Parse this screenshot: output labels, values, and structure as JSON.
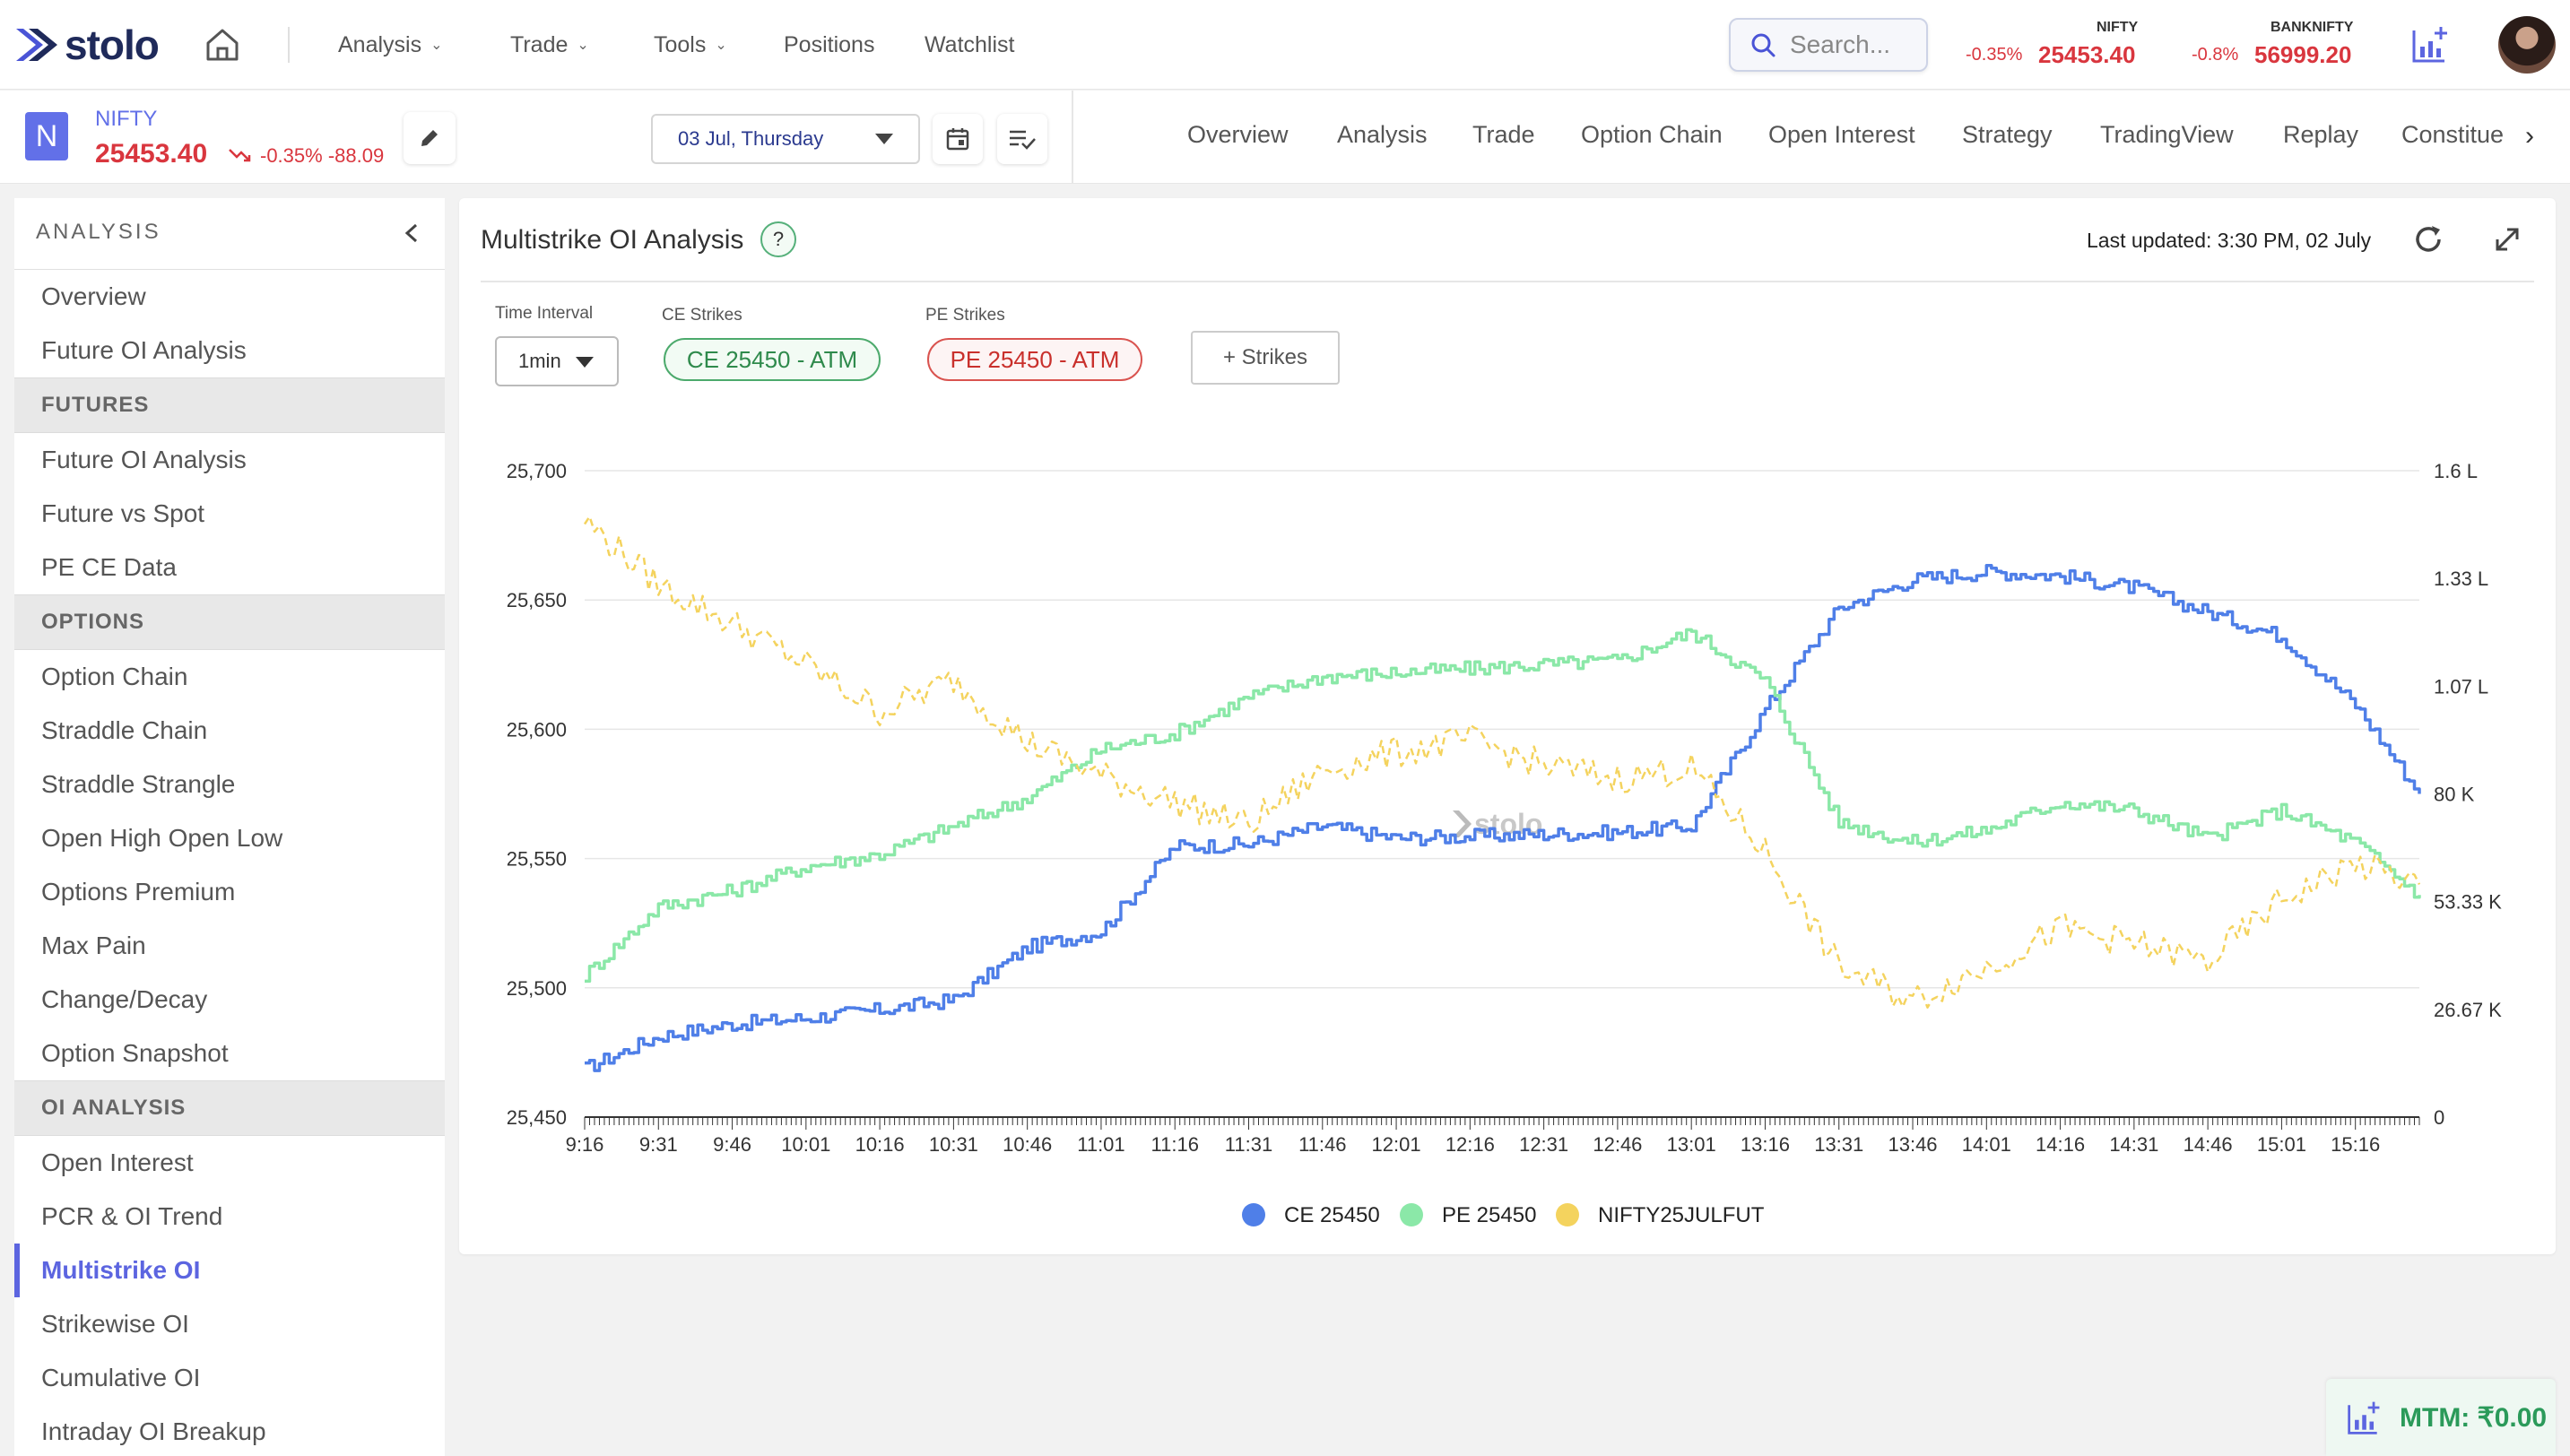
{
  "brand": {
    "name": "stolo"
  },
  "topnav": [
    {
      "label": "Analysis",
      "dropdown": true
    },
    {
      "label": "Trade",
      "dropdown": true
    },
    {
      "label": "Tools",
      "dropdown": true
    },
    {
      "label": "Positions",
      "dropdown": false
    },
    {
      "label": "Watchlist",
      "dropdown": false
    }
  ],
  "search": {
    "placeholder": "Search..."
  },
  "tickers": [
    {
      "name": "NIFTY",
      "change": "-0.35%",
      "value": "25453.40"
    },
    {
      "name": "BANKNIFTY",
      "change": "-0.8%",
      "value": "56999.20"
    }
  ],
  "symbol": {
    "badge": "N",
    "name": "NIFTY",
    "price": "25453.40",
    "change": "-0.35% -88.09"
  },
  "date_select": {
    "value": "03 Jul, Thursday"
  },
  "subtabs": [
    "Overview",
    "Analysis",
    "Trade",
    "Option Chain",
    "Open Interest",
    "Strategy",
    "TradingView",
    "Replay",
    "Constitue"
  ],
  "sidebar": {
    "title": "ANALYSIS",
    "entries": [
      {
        "kind": "item",
        "label": "Overview"
      },
      {
        "kind": "item",
        "label": "Future OI Analysis"
      },
      {
        "kind": "section",
        "label": "FUTURES"
      },
      {
        "kind": "item",
        "label": "Future OI Analysis"
      },
      {
        "kind": "item",
        "label": "Future vs Spot"
      },
      {
        "kind": "item",
        "label": "PE CE Data"
      },
      {
        "kind": "section",
        "label": "OPTIONS"
      },
      {
        "kind": "item",
        "label": "Option Chain"
      },
      {
        "kind": "item",
        "label": "Straddle Chain"
      },
      {
        "kind": "item",
        "label": "Straddle Strangle"
      },
      {
        "kind": "item",
        "label": "Open High Open Low"
      },
      {
        "kind": "item",
        "label": "Options Premium"
      },
      {
        "kind": "item",
        "label": "Max Pain"
      },
      {
        "kind": "item",
        "label": "Change/Decay"
      },
      {
        "kind": "item",
        "label": "Option Snapshot"
      },
      {
        "kind": "section",
        "label": "OI ANALYSIS"
      },
      {
        "kind": "item",
        "label": "Open Interest"
      },
      {
        "kind": "item",
        "label": "PCR & OI Trend"
      },
      {
        "kind": "item",
        "label": "Multistrike OI",
        "active": true
      },
      {
        "kind": "item",
        "label": "Strikewise OI"
      },
      {
        "kind": "item",
        "label": "Cumulative OI"
      },
      {
        "kind": "item",
        "label": "Intraday OI Breakup"
      }
    ]
  },
  "panel": {
    "title": "Multistrike OI Analysis",
    "help": "?",
    "last_updated": "Last updated: 3:30 PM, 02 July",
    "time_interval_label": "Time Interval",
    "time_interval_value": "1min",
    "ce_label": "CE Strikes",
    "ce_pill": "CE 25450 - ATM",
    "pe_label": "PE Strikes",
    "pe_pill": "PE 25450 - ATM",
    "add_strikes": "+ Strikes"
  },
  "mtm": {
    "label": "MTM: ₹0.00"
  },
  "colors": {
    "accent": "#5c65e0",
    "negative": "#d9363e",
    "ce_series": "#4f7fe8",
    "pe_series": "#8be8a8",
    "fut_series": "#f4d35e",
    "mtm": "#2b9a5a"
  },
  "chart_data": {
    "type": "line",
    "watermark": "stolo",
    "x_ticks": [
      "9:16",
      "9:31",
      "9:46",
      "10:01",
      "10:16",
      "10:31",
      "10:46",
      "11:01",
      "11:16",
      "11:31",
      "11:46",
      "12:01",
      "12:16",
      "12:31",
      "12:46",
      "13:01",
      "13:16",
      "13:31",
      "13:46",
      "14:01",
      "14:16",
      "14:31",
      "14:46",
      "15:01",
      "15:16"
    ],
    "x": [
      "9:16",
      "9:31",
      "9:46",
      "10:01",
      "10:16",
      "10:31",
      "10:46",
      "11:01",
      "11:16",
      "11:31",
      "11:46",
      "12:01",
      "12:16",
      "12:31",
      "12:46",
      "13:01",
      "13:16",
      "13:31",
      "13:46",
      "14:01",
      "14:16",
      "14:31",
      "14:46",
      "15:01",
      "15:16",
      "15:29"
    ],
    "left_axis": {
      "ticks": [
        "25,450",
        "25,500",
        "25,550",
        "25,600",
        "25,650",
        "25,700"
      ],
      "range": [
        25450,
        25700
      ]
    },
    "right_axis": {
      "ticks": [
        "0",
        "26.67 K",
        "53.33 K",
        "80 K",
        "1.07 L",
        "1.33 L",
        "1.6 L"
      ],
      "range": [
        0,
        160000
      ]
    },
    "grid": true,
    "legend_position": "bottom",
    "series": [
      {
        "name": "CE 25450",
        "axis": "right",
        "style": "solid",
        "color": "#4f7fe8",
        "values": [
          12000,
          20000,
          23000,
          24500,
          26500,
          29000,
          42000,
          46000,
          67000,
          67500,
          72000,
          69000,
          69500,
          70000,
          70500,
          72000,
          101000,
          126000,
          133000,
          135000,
          134000,
          131000,
          125000,
          119000,
          102000,
          80000
        ]
      },
      {
        "name": "PE 25450",
        "axis": "right",
        "style": "solid",
        "color": "#8be8a8",
        "values": [
          35000,
          52000,
          56000,
          62000,
          65000,
          72000,
          79000,
          91000,
          95000,
          104000,
          109000,
          110000,
          111000,
          112000,
          113000,
          120000,
          108000,
          73000,
          68000,
          71000,
          78000,
          76000,
          69000,
          76000,
          68000,
          55000
        ]
      },
      {
        "name": "NIFTY25JULFUT",
        "axis": "left",
        "style": "dashed",
        "color": "#f4d35e",
        "values": [
          25681,
          25656,
          25641,
          25625,
          25607,
          25619,
          25595,
          25582,
          25572,
          25563,
          25584,
          25591,
          25596,
          25586,
          25581,
          25585,
          25553,
          25508,
          25495,
          25508,
          25523,
          25517,
          25510,
          25534,
          25548,
          25540
        ]
      }
    ]
  }
}
